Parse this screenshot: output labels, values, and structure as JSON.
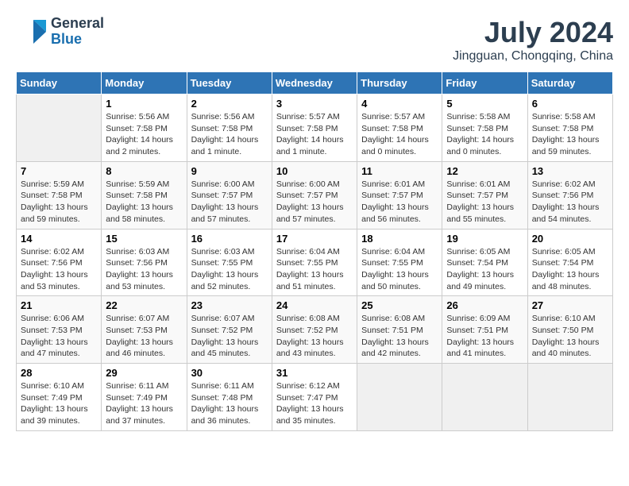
{
  "header": {
    "logo_general": "General",
    "logo_blue": "Blue",
    "month_year": "July 2024",
    "location": "Jingguan, Chongqing, China"
  },
  "weekdays": [
    "Sunday",
    "Monday",
    "Tuesday",
    "Wednesday",
    "Thursday",
    "Friday",
    "Saturday"
  ],
  "weeks": [
    [
      {
        "day": "",
        "info": ""
      },
      {
        "day": "1",
        "info": "Sunrise: 5:56 AM\nSunset: 7:58 PM\nDaylight: 14 hours\nand 2 minutes."
      },
      {
        "day": "2",
        "info": "Sunrise: 5:56 AM\nSunset: 7:58 PM\nDaylight: 14 hours\nand 1 minute."
      },
      {
        "day": "3",
        "info": "Sunrise: 5:57 AM\nSunset: 7:58 PM\nDaylight: 14 hours\nand 1 minute."
      },
      {
        "day": "4",
        "info": "Sunrise: 5:57 AM\nSunset: 7:58 PM\nDaylight: 14 hours\nand 0 minutes."
      },
      {
        "day": "5",
        "info": "Sunrise: 5:58 AM\nSunset: 7:58 PM\nDaylight: 14 hours\nand 0 minutes."
      },
      {
        "day": "6",
        "info": "Sunrise: 5:58 AM\nSunset: 7:58 PM\nDaylight: 13 hours\nand 59 minutes."
      }
    ],
    [
      {
        "day": "7",
        "info": "Sunrise: 5:59 AM\nSunset: 7:58 PM\nDaylight: 13 hours\nand 59 minutes."
      },
      {
        "day": "8",
        "info": "Sunrise: 5:59 AM\nSunset: 7:58 PM\nDaylight: 13 hours\nand 58 minutes."
      },
      {
        "day": "9",
        "info": "Sunrise: 6:00 AM\nSunset: 7:57 PM\nDaylight: 13 hours\nand 57 minutes."
      },
      {
        "day": "10",
        "info": "Sunrise: 6:00 AM\nSunset: 7:57 PM\nDaylight: 13 hours\nand 57 minutes."
      },
      {
        "day": "11",
        "info": "Sunrise: 6:01 AM\nSunset: 7:57 PM\nDaylight: 13 hours\nand 56 minutes."
      },
      {
        "day": "12",
        "info": "Sunrise: 6:01 AM\nSunset: 7:57 PM\nDaylight: 13 hours\nand 55 minutes."
      },
      {
        "day": "13",
        "info": "Sunrise: 6:02 AM\nSunset: 7:56 PM\nDaylight: 13 hours\nand 54 minutes."
      }
    ],
    [
      {
        "day": "14",
        "info": "Sunrise: 6:02 AM\nSunset: 7:56 PM\nDaylight: 13 hours\nand 53 minutes."
      },
      {
        "day": "15",
        "info": "Sunrise: 6:03 AM\nSunset: 7:56 PM\nDaylight: 13 hours\nand 53 minutes."
      },
      {
        "day": "16",
        "info": "Sunrise: 6:03 AM\nSunset: 7:55 PM\nDaylight: 13 hours\nand 52 minutes."
      },
      {
        "day": "17",
        "info": "Sunrise: 6:04 AM\nSunset: 7:55 PM\nDaylight: 13 hours\nand 51 minutes."
      },
      {
        "day": "18",
        "info": "Sunrise: 6:04 AM\nSunset: 7:55 PM\nDaylight: 13 hours\nand 50 minutes."
      },
      {
        "day": "19",
        "info": "Sunrise: 6:05 AM\nSunset: 7:54 PM\nDaylight: 13 hours\nand 49 minutes."
      },
      {
        "day": "20",
        "info": "Sunrise: 6:05 AM\nSunset: 7:54 PM\nDaylight: 13 hours\nand 48 minutes."
      }
    ],
    [
      {
        "day": "21",
        "info": "Sunrise: 6:06 AM\nSunset: 7:53 PM\nDaylight: 13 hours\nand 47 minutes."
      },
      {
        "day": "22",
        "info": "Sunrise: 6:07 AM\nSunset: 7:53 PM\nDaylight: 13 hours\nand 46 minutes."
      },
      {
        "day": "23",
        "info": "Sunrise: 6:07 AM\nSunset: 7:52 PM\nDaylight: 13 hours\nand 45 minutes."
      },
      {
        "day": "24",
        "info": "Sunrise: 6:08 AM\nSunset: 7:52 PM\nDaylight: 13 hours\nand 43 minutes."
      },
      {
        "day": "25",
        "info": "Sunrise: 6:08 AM\nSunset: 7:51 PM\nDaylight: 13 hours\nand 42 minutes."
      },
      {
        "day": "26",
        "info": "Sunrise: 6:09 AM\nSunset: 7:51 PM\nDaylight: 13 hours\nand 41 minutes."
      },
      {
        "day": "27",
        "info": "Sunrise: 6:10 AM\nSunset: 7:50 PM\nDaylight: 13 hours\nand 40 minutes."
      }
    ],
    [
      {
        "day": "28",
        "info": "Sunrise: 6:10 AM\nSunset: 7:49 PM\nDaylight: 13 hours\nand 39 minutes."
      },
      {
        "day": "29",
        "info": "Sunrise: 6:11 AM\nSunset: 7:49 PM\nDaylight: 13 hours\nand 37 minutes."
      },
      {
        "day": "30",
        "info": "Sunrise: 6:11 AM\nSunset: 7:48 PM\nDaylight: 13 hours\nand 36 minutes."
      },
      {
        "day": "31",
        "info": "Sunrise: 6:12 AM\nSunset: 7:47 PM\nDaylight: 13 hours\nand 35 minutes."
      },
      {
        "day": "",
        "info": ""
      },
      {
        "day": "",
        "info": ""
      },
      {
        "day": "",
        "info": ""
      }
    ]
  ]
}
